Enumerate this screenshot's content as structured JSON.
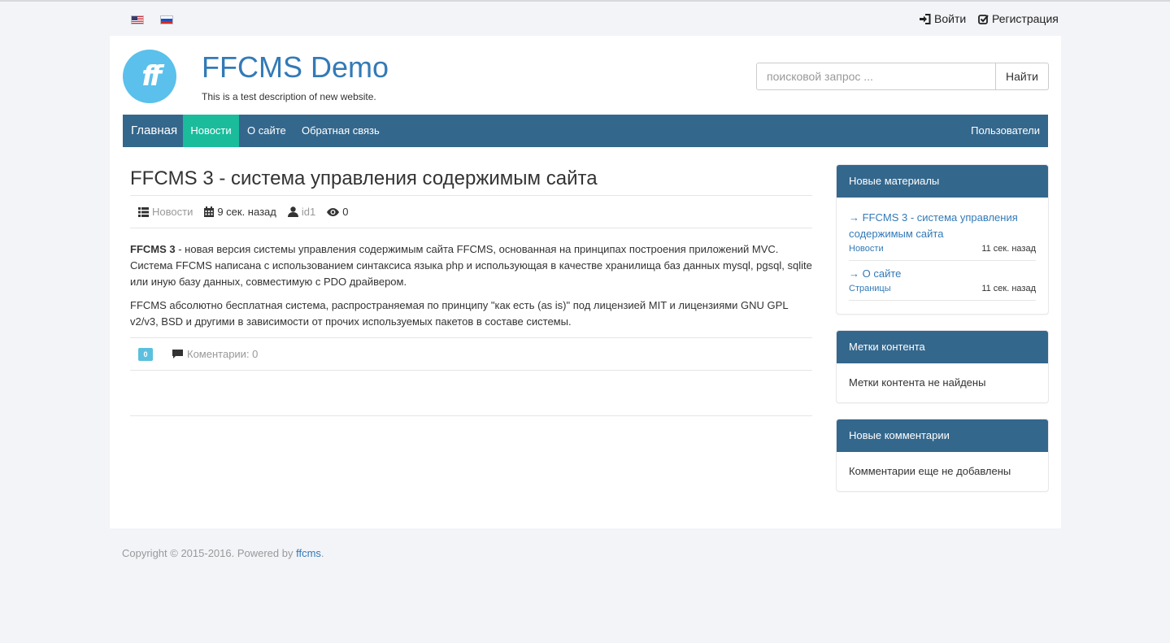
{
  "topbar": {
    "lang_en": "English",
    "lang_ru": "Русский",
    "login_label": "Войти",
    "register_label": "Регистрация"
  },
  "header": {
    "site_title": "FFCMS Demo",
    "site_description": "This is a test description of new website.",
    "search_placeholder": "поисковой запрос ...",
    "search_button": "Найти"
  },
  "nav": {
    "items": [
      {
        "label": "Главная"
      },
      {
        "label": "Новости",
        "active": true
      },
      {
        "label": "О сайте"
      },
      {
        "label": "Обратная связь"
      }
    ],
    "right_label": "Пользователи"
  },
  "article": {
    "title": "FFCMS 3 - система управления содержимым сайта",
    "category": "Новости",
    "date": "9 сек. назад",
    "author": "id1",
    "views": "0",
    "p1_bold": "FFCMS 3",
    "p1_rest": " - новая версия системы управления содержимым сайта FFCMS, основанная на принципах построения приложений MVC. Система FFCMS написана с использованием синтаксиса языка php и использующая в качестве хранилища баз данных mysql, pgsql, sqlite или иную базу данных, совместимую с PDO драйвером.",
    "p2": "FFCMS абсолютно бесплатная система, распространяемая по принципу \"как есть (as is)\" под лицензией MIT и лицензиями GNU GPL v2/v3, BSD и другими в зависимости от прочих используемых пакетов в составе системы.",
    "rating": "0",
    "comments_label": "Коментарии: 0"
  },
  "sidebar": {
    "new_materials": {
      "title": "Новые материалы",
      "items": [
        {
          "title": "→ FFCMS 3 - система управления содержимым сайта",
          "category": "Новости",
          "time": "11 сек. назад"
        },
        {
          "title": "→ О сайте",
          "category": "Страницы",
          "time": "11 сек. назад"
        }
      ]
    },
    "tags": {
      "title": "Метки контента",
      "empty_text": "Метки контента не найдены"
    },
    "comments": {
      "title": "Новые комментарии",
      "empty_text": "Комментарии еще не добавлены"
    }
  },
  "footer": {
    "copyright_prefix": "Copyright © 2015-2016. Powered by ",
    "powered_link": "ffcms",
    "copyright_suffix": "."
  },
  "colors": {
    "nav_bg": "#34678c",
    "nav_active": "#1abc9c",
    "link": "#337ab7",
    "logo": "#5bc0eb",
    "badge": "#5bc0de"
  },
  "icons": [
    "flag-us-icon",
    "flag-ru-icon",
    "login-icon",
    "check-square-icon",
    "list-icon",
    "calendar-icon",
    "user-icon",
    "eye-icon",
    "comment-icon"
  ]
}
